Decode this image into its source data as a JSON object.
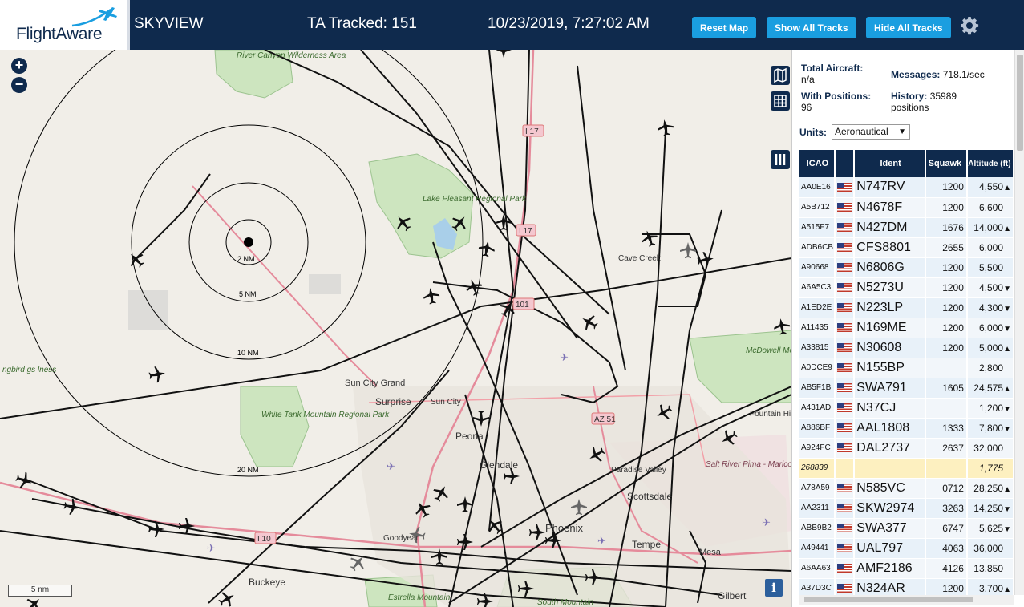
{
  "header": {
    "logo_text": "FlightAware",
    "site_name": "SKYVIEW",
    "tracked": "TA Tracked: 151",
    "datetime": "10/23/2019, 7:27:02 AM",
    "buttons": {
      "reset": "Reset Map",
      "show_all": "Show All Tracks",
      "hide_all": "Hide All Tracks"
    },
    "settings_icon": "gear-icon"
  },
  "map": {
    "zoom_in": "+",
    "zoom_out": "−",
    "scale": "5 nm",
    "info": "i",
    "rings": [
      "2 NM",
      "5 NM",
      "10 NM",
      "20 NM"
    ],
    "places": [
      "River Canyon Wilderness Area",
      "Lake Pleasant Regional Park",
      "Cave Creek",
      "Sun City Grand",
      "Surprise",
      "Sun City",
      "White Tank Mountain Regional Park",
      "Peoria",
      "Glendale",
      "Paradise Valley",
      "Scottsdale",
      "Salt River Pima - Maricopa Indian Community",
      "Phoenix",
      "Tempe",
      "Mesa",
      "Goodyear",
      "Buckeye",
      "Estrella Mountain",
      "South Mountain",
      "Gilbert",
      "McDowell Mountain Regional Park",
      "Fountain Hills",
      "ngbird gs lness"
    ],
    "highways": [
      "I 17",
      "I 17",
      "I 10",
      "AZ 51",
      "101"
    ],
    "controls": [
      "map-layers-icon",
      "grid-icon",
      "columns-icon"
    ]
  },
  "panel": {
    "stats": {
      "total_label": "Total Aircraft:",
      "total_value": "n/a",
      "positions_label": "With Positions:",
      "positions_value": "96",
      "messages_label": "Messages:",
      "messages_value": "718.1/sec",
      "history_label": "History:",
      "history_value": "35989 positions"
    },
    "units_label": "Units:",
    "units_value": "Aeronautical",
    "columns": [
      "ICAO",
      "",
      "Ident",
      "Squawk",
      "Altitude (ft)"
    ],
    "rows": [
      {
        "icao": "AA0E16",
        "ident": "N747RV",
        "squawk": "1200",
        "alt": "4,550",
        "trend": "▲"
      },
      {
        "icao": "A5B712",
        "ident": "N4678F",
        "squawk": "1200",
        "alt": "6,600",
        "trend": ""
      },
      {
        "icao": "A515F7",
        "ident": "N427DM",
        "squawk": "1676",
        "alt": "14,000",
        "trend": "▲"
      },
      {
        "icao": "ADB6CB",
        "ident": "CFS8801",
        "squawk": "2655",
        "alt": "6,000",
        "trend": ""
      },
      {
        "icao": "A90668",
        "ident": "N6806G",
        "squawk": "1200",
        "alt": "5,500",
        "trend": ""
      },
      {
        "icao": "A6A5C3",
        "ident": "N5273U",
        "squawk": "1200",
        "alt": "4,500",
        "trend": "▼"
      },
      {
        "icao": "A1ED2E",
        "ident": "N223LP",
        "squawk": "1200",
        "alt": "4,300",
        "trend": "▼"
      },
      {
        "icao": "A11435",
        "ident": "N169ME",
        "squawk": "1200",
        "alt": "6,000",
        "trend": "▼"
      },
      {
        "icao": "A33815",
        "ident": "N30608",
        "squawk": "1200",
        "alt": "5,000",
        "trend": "▲"
      },
      {
        "icao": "A0DCE9",
        "ident": "N155BP",
        "squawk": "",
        "alt": "2,800",
        "trend": ""
      },
      {
        "icao": "AB5F1B",
        "ident": "SWA791",
        "squawk": "1605",
        "alt": "24,575",
        "trend": "▲"
      },
      {
        "icao": "A431AD",
        "ident": "N37CJ",
        "squawk": "",
        "alt": "1,200",
        "trend": "▼"
      },
      {
        "icao": "A886BF",
        "ident": "AAL1808",
        "squawk": "1333",
        "alt": "7,800",
        "trend": "▼"
      },
      {
        "icao": "A924FC",
        "ident": "DAL2737",
        "squawk": "2637",
        "alt": "32,000",
        "trend": ""
      },
      {
        "icao": "268839",
        "ident": "",
        "squawk": "",
        "alt": "1,775",
        "trend": "",
        "selected": true
      },
      {
        "icao": "A78A59",
        "ident": "N585VC",
        "squawk": "0712",
        "alt": "28,250",
        "trend": "▲"
      },
      {
        "icao": "AA2311",
        "ident": "SKW2974",
        "squawk": "3263",
        "alt": "14,250",
        "trend": "▼"
      },
      {
        "icao": "ABB9B2",
        "ident": "SWA377",
        "squawk": "6747",
        "alt": "5,625",
        "trend": "▼"
      },
      {
        "icao": "A49441",
        "ident": "UAL797",
        "squawk": "4063",
        "alt": "36,000",
        "trend": ""
      },
      {
        "icao": "A6AA63",
        "ident": "AMF2186",
        "squawk": "4126",
        "alt": "13,850",
        "trend": ""
      },
      {
        "icao": "A37D3C",
        "ident": "N324AR",
        "squawk": "1200",
        "alt": "3,700",
        "trend": "▲"
      }
    ]
  }
}
